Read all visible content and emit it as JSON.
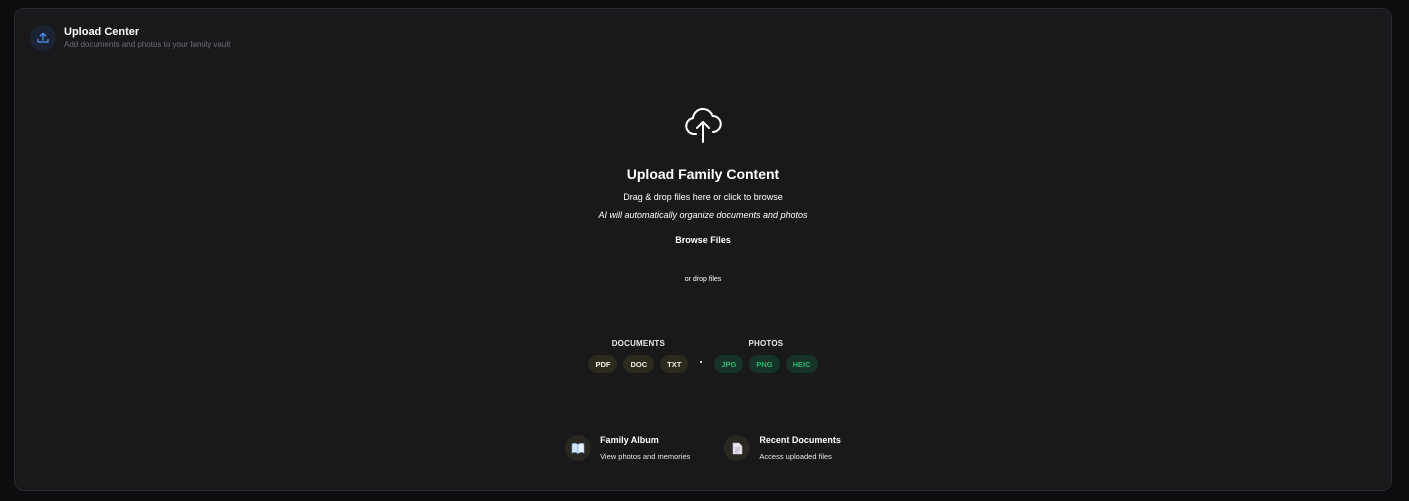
{
  "header": {
    "title": "Upload Center",
    "subtitle": "Add documents and photos to your family vault",
    "icon": "upload-icon"
  },
  "dropzone": {
    "icon": "cloud-upload-icon",
    "title": "Upload Family Content",
    "description": "Drag & drop files here or click to browse",
    "ai_note": "AI will automatically organize documents and photos",
    "browse_label": "Browse Files",
    "drop_hint": "or drop files"
  },
  "file_types": {
    "documents": {
      "label": "DOCUMENTS",
      "types": [
        "PDF",
        "DOC",
        "TXT"
      ],
      "chip_color": "#2d2a1e"
    },
    "photos": {
      "label": "PHOTOS",
      "types": [
        "JPG",
        "PNG",
        "HEIC"
      ],
      "chip_color": "#173428",
      "text_color": "#2bb673"
    }
  },
  "quick_links": [
    {
      "title": "Family Album",
      "subtitle": "View photos and memories",
      "icon": "book-icon"
    },
    {
      "title": "Recent Documents",
      "subtitle": "Access uploaded files",
      "icon": "document-icon"
    }
  ],
  "colors": {
    "background": "#0d0d10",
    "panel": "#19191c",
    "accent": "#4f8ef7"
  }
}
